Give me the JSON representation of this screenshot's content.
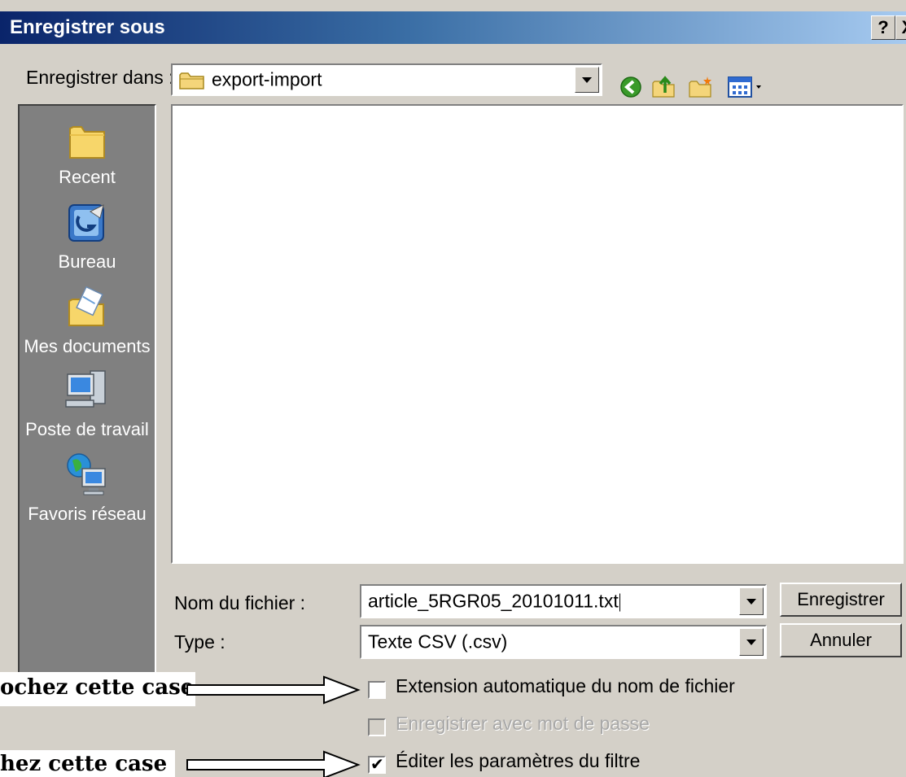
{
  "window": {
    "title": "Enregistrer sous",
    "help_btn": "?",
    "close_btn": "X"
  },
  "location": {
    "label": "Enregistrer dans :",
    "value": "export-import"
  },
  "places": [
    {
      "label": "Recent",
      "icon": "recent-folder-icon"
    },
    {
      "label": "Bureau",
      "icon": "desktop-icon"
    },
    {
      "label": "Mes documents",
      "icon": "my-documents-icon"
    },
    {
      "label": "Poste de travail",
      "icon": "my-computer-icon"
    },
    {
      "label": "Favoris réseau",
      "icon": "network-places-icon"
    }
  ],
  "filename": {
    "label": "Nom du fichier :",
    "value": "article_5RGR05_20101011.txt"
  },
  "filetype": {
    "label": "Type :",
    "value": "Texte CSV (.csv)"
  },
  "buttons": {
    "save": "Enregistrer",
    "cancel": "Annuler"
  },
  "options": [
    {
      "label": "Extension automatique du nom de fichier",
      "checked": false,
      "enabled": true
    },
    {
      "label": "Enregistrer avec mot de passe",
      "checked": false,
      "enabled": false
    },
    {
      "label": "Éditer les paramètres du filtre",
      "checked": true,
      "enabled": true
    }
  ],
  "annotations": [
    "ochez cette case",
    "hez cette case"
  ]
}
